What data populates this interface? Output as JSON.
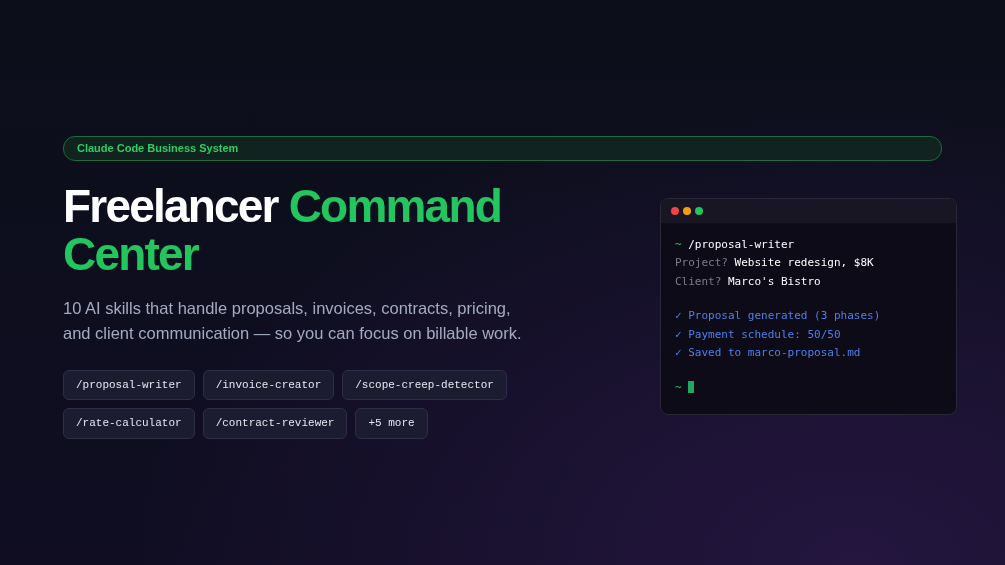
{
  "badge": {
    "label": "Claude Code Business System"
  },
  "title": [
    {
      "text": "Freelancer",
      "accent": false
    },
    {
      "text": "Command Center",
      "accent": true
    }
  ],
  "description": "10 AI skills that handle proposals, invoices, contracts, pricing, and client communication — so you can focus on billable work.",
  "skills": [
    "/proposal-writer",
    "/invoice-creator",
    "/scope-creep-detector",
    "/rate-calculator",
    "/contract-reviewer",
    "+5 more"
  ],
  "terminal": {
    "window_dots": [
      {
        "color": "#ef4444"
      },
      {
        "color": "#f59e0b"
      },
      {
        "color": "#22c55e"
      }
    ],
    "blocks": [
      [
        {
          "kind": "command",
          "prompt": "~",
          "text": "/proposal-writer"
        },
        {
          "kind": "qa",
          "label": "Project?",
          "value": "Website redesign, $8K"
        },
        {
          "kind": "qa",
          "label": "Client?",
          "value": "Marco's Bistro"
        }
      ],
      [
        {
          "kind": "success",
          "mark": "✓",
          "text": "Proposal generated (3 phases)"
        },
        {
          "kind": "success",
          "mark": "✓",
          "text": "Payment schedule: 50/50"
        },
        {
          "kind": "success",
          "mark": "✓",
          "text": "Saved to marco-proposal.md"
        }
      ],
      [
        {
          "kind": "cursor",
          "prompt": "~"
        }
      ]
    ]
  }
}
